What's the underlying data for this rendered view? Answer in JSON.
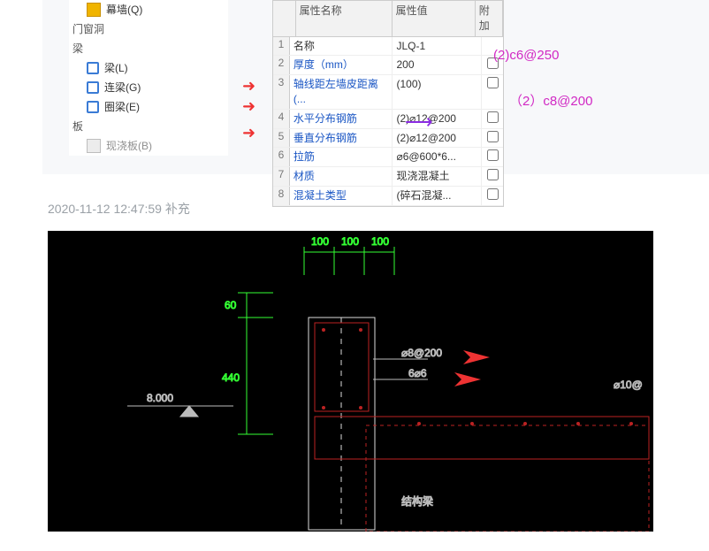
{
  "sidebar": {
    "i0": "幕墙(Q)",
    "g1": "门窗洞",
    "g2": "梁",
    "i1": "梁(L)",
    "i2": "连梁(G)",
    "i3": "圈梁(E)",
    "g3": "板",
    "i4": "现浇板(B)"
  },
  "grid": {
    "h1": "属性名称",
    "h2": "属性值",
    "h3": "附加",
    "rows": [
      {
        "n": "1",
        "a": "名称",
        "b": "JLQ-1"
      },
      {
        "n": "2",
        "a": "厚度（mm）",
        "b": "200"
      },
      {
        "n": "3",
        "a": "轴线距左墙皮距离(...",
        "b": "(100)"
      },
      {
        "n": "4",
        "a": "水平分布钢筋",
        "b": "(2)⌀12@200"
      },
      {
        "n": "5",
        "a": "垂直分布钢筋",
        "b": "(2)⌀12@200"
      },
      {
        "n": "6",
        "a": "拉筋",
        "b": "⌀6@600*6..."
      },
      {
        "n": "7",
        "a": "材质",
        "b": "现浇混凝土"
      },
      {
        "n": "8",
        "a": "混凝土类型",
        "b": "(碎石混凝..."
      }
    ]
  },
  "annot": {
    "a1": "(2)c6@250",
    "a2": "（2）c8@200"
  },
  "ts": "2020-11-12 12:47:59 补充",
  "cad": {
    "d1": "100",
    "d2": "100",
    "d3": "100",
    "d60": "60",
    "d440": "440",
    "elev": "8.000",
    "t1": "⌀8@200",
    "t2": "6⌀6",
    "t3": "⌀10@",
    "t4": "结构梁"
  }
}
